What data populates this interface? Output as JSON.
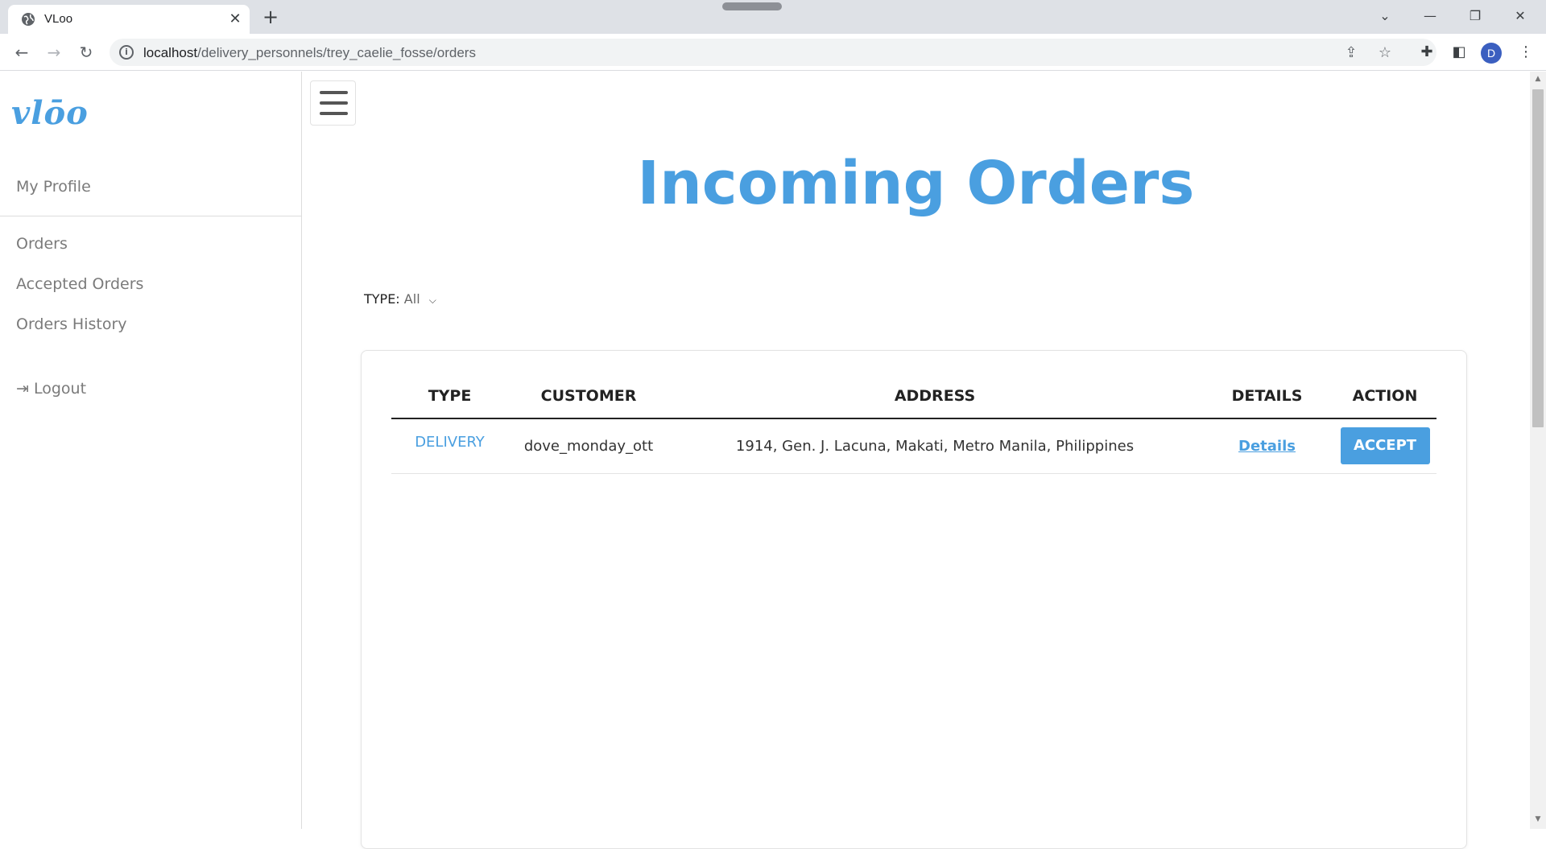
{
  "browser": {
    "tab_title": "VLoo",
    "tab_close": "✕",
    "new_tab": "+",
    "url_host": "localhost",
    "url_path": "/delivery_personnels/trey_caelie_fosse/orders",
    "profile_initial": "D"
  },
  "sidebar": {
    "logo": "vlōo",
    "my_profile": "My Profile",
    "items": [
      "Orders",
      "Accepted Orders",
      "Orders History"
    ],
    "logout": "Logout"
  },
  "main": {
    "heading": "Incoming Orders",
    "filter": {
      "label": "TYPE:",
      "value": "All"
    },
    "table": {
      "headers": [
        "TYPE",
        "CUSTOMER",
        "ADDRESS",
        "DETAILS",
        "ACTION"
      ],
      "rows": [
        {
          "type": "DELIVERY",
          "customer": "dove_monday_ott",
          "address": "1914, Gen. J. Lacuna, Makati, Metro Manila, Philippines",
          "details": "Details",
          "action": "ACCEPT"
        }
      ]
    }
  },
  "colors": {
    "accent": "#4a9fe0"
  }
}
